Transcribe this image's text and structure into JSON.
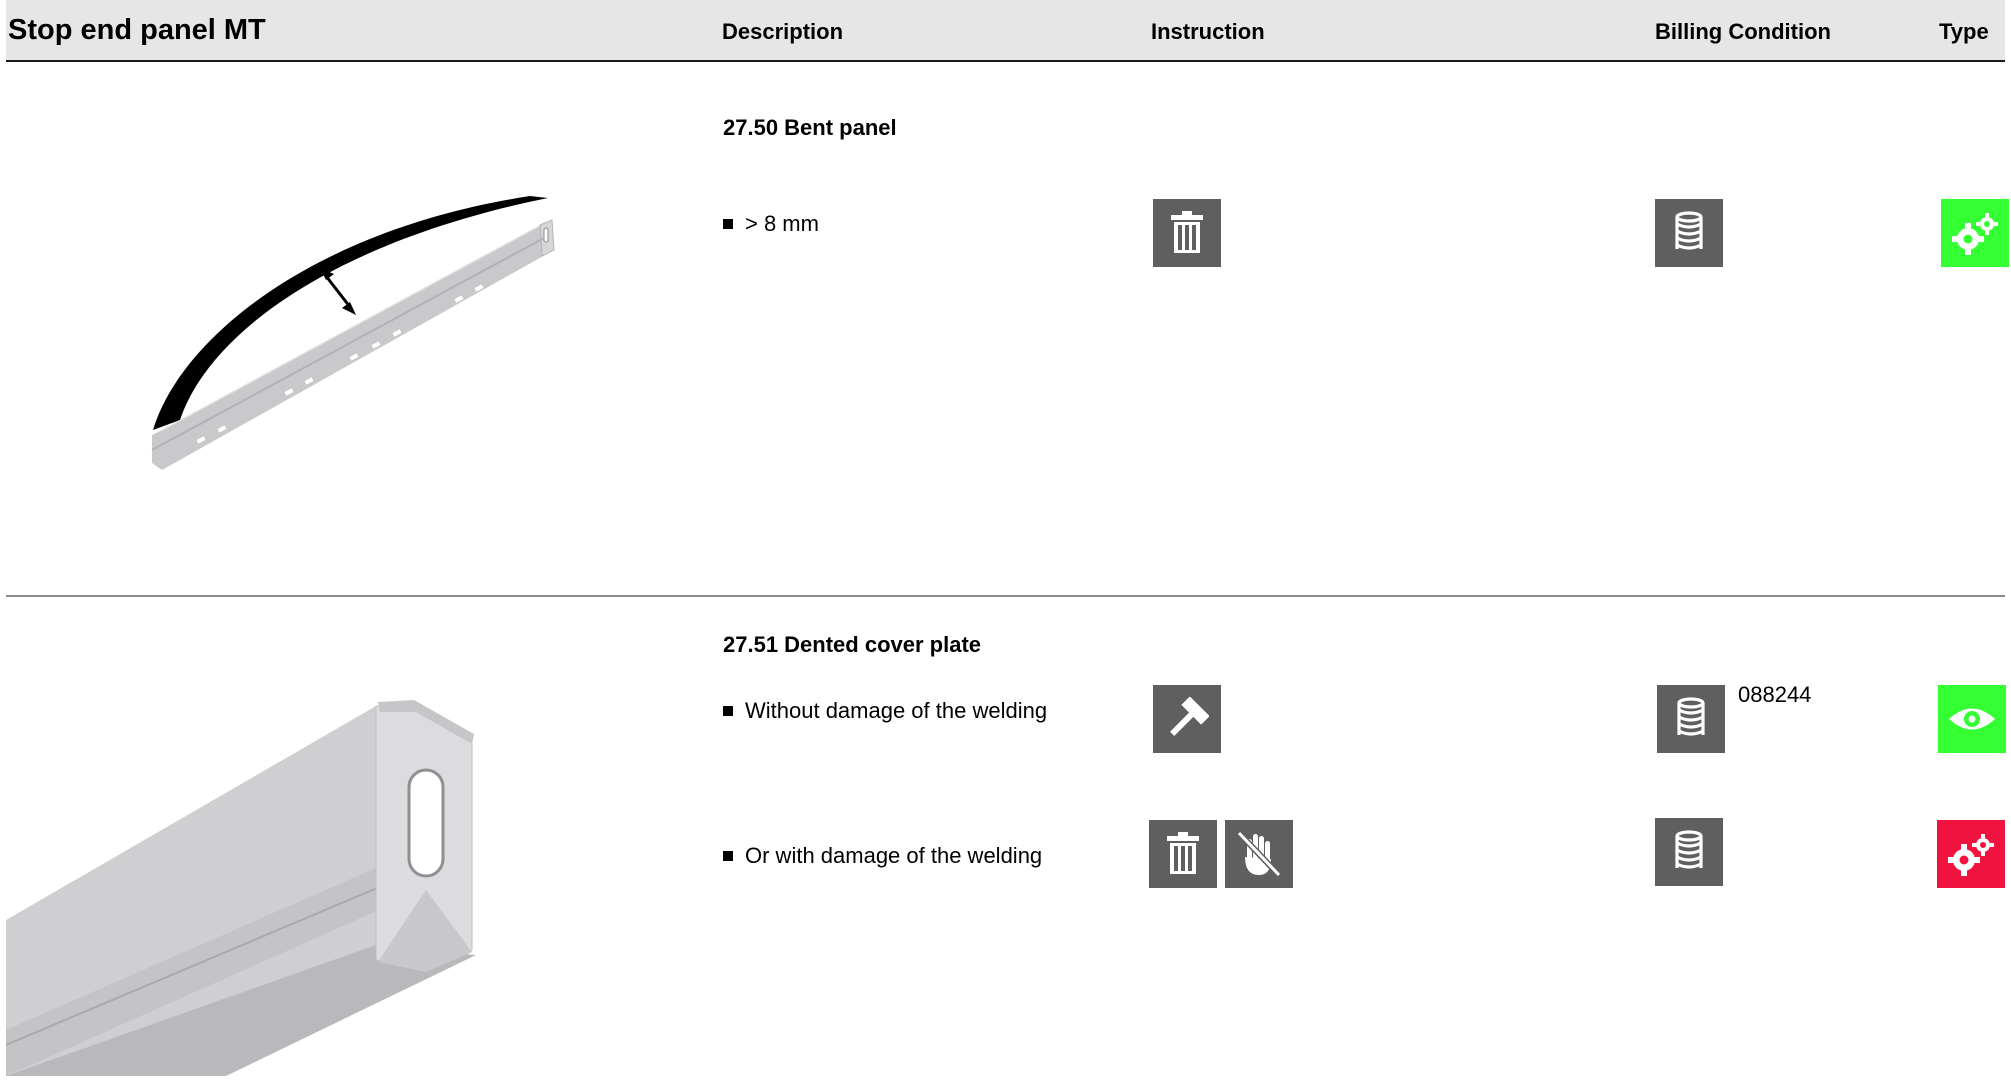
{
  "header": {
    "title": "Stop end panel MT",
    "col_description": "Description",
    "col_instruction": "Instruction",
    "col_billing": "Billing Condition",
    "col_type": "Type"
  },
  "sections": [
    {
      "title": "27.50 Bent panel",
      "image": "bent-panel-illustration",
      "rows": [
        {
          "text": "> 8 mm",
          "instructions": [
            "trash-icon"
          ],
          "billing_icon": "coin-stack-icon",
          "billing_code": "",
          "type_icon": "gears-icon",
          "type_color": "#33ff33"
        }
      ]
    },
    {
      "title": "27.51 Dented cover plate",
      "image": "cover-plate-illustration",
      "rows": [
        {
          "text": "Without damage of the welding",
          "instructions": [
            "hammer-icon"
          ],
          "billing_icon": "coin-stack-icon",
          "billing_code": "088244",
          "type_icon": "eye-icon",
          "type_color": "#33ff33"
        },
        {
          "text": "Or with damage of the welding",
          "instructions": [
            "trash-icon",
            "no-hand-repair-icon"
          ],
          "billing_icon": "coin-stack-icon",
          "billing_code": "",
          "type_icon": "gears-icon",
          "type_color": "#f0133f"
        }
      ]
    }
  ]
}
